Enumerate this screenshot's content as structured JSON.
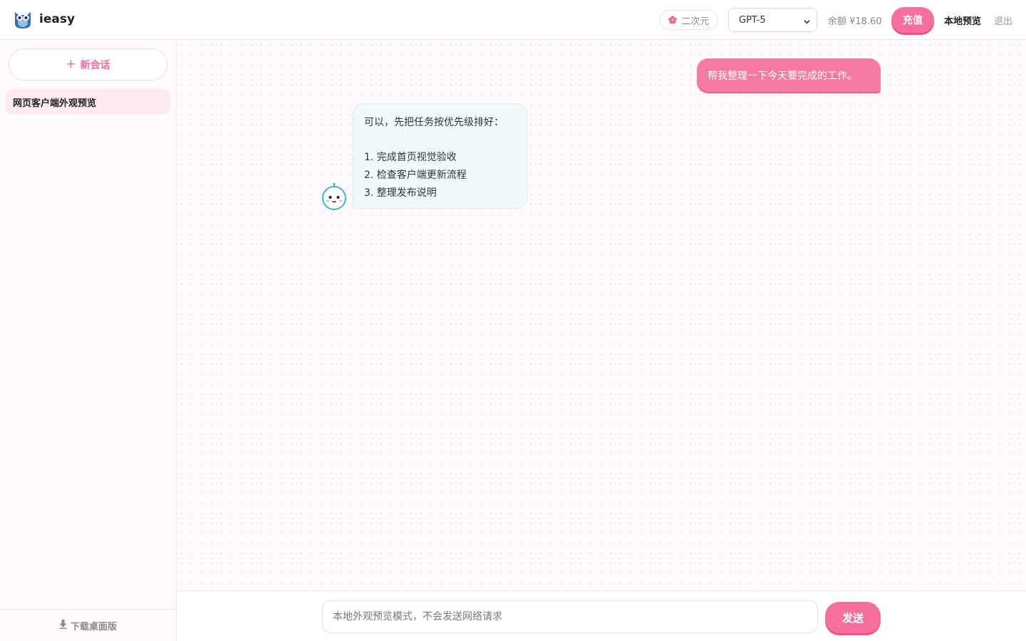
{
  "header": {
    "brand": "ieasy",
    "theme_label": "二次元",
    "model_selected": "GPT-5",
    "balance": "余额 ¥18.60",
    "recharge_label": "充值",
    "local_preview_label": "本地预览",
    "logout_label": "退出"
  },
  "sidebar": {
    "new_chat_label": "新会话",
    "conversations": [
      {
        "title": "网页客户端外观预览",
        "active": true
      }
    ],
    "download_label": "下载桌面版"
  },
  "messages": [
    {
      "role": "user",
      "text": "帮我整理一下今天要完成的工作。"
    },
    {
      "role": "assistant",
      "lines": [
        "可以，先把任务按优先级排好：",
        "1. 完成首页视觉验收",
        "2. 检查客户端更新流程",
        "3. 整理发布说明"
      ]
    }
  ],
  "composer": {
    "placeholder": "本地外观预览模式，不会发送网络请求",
    "value": "",
    "send_label": "发送"
  },
  "colors": {
    "accent": "#f76f9a",
    "accent_shadow": "#e45585",
    "user_bubble": "#f97aa0",
    "bot_bubble": "#f1fbfc",
    "active_conversation": "#fdebf1"
  }
}
